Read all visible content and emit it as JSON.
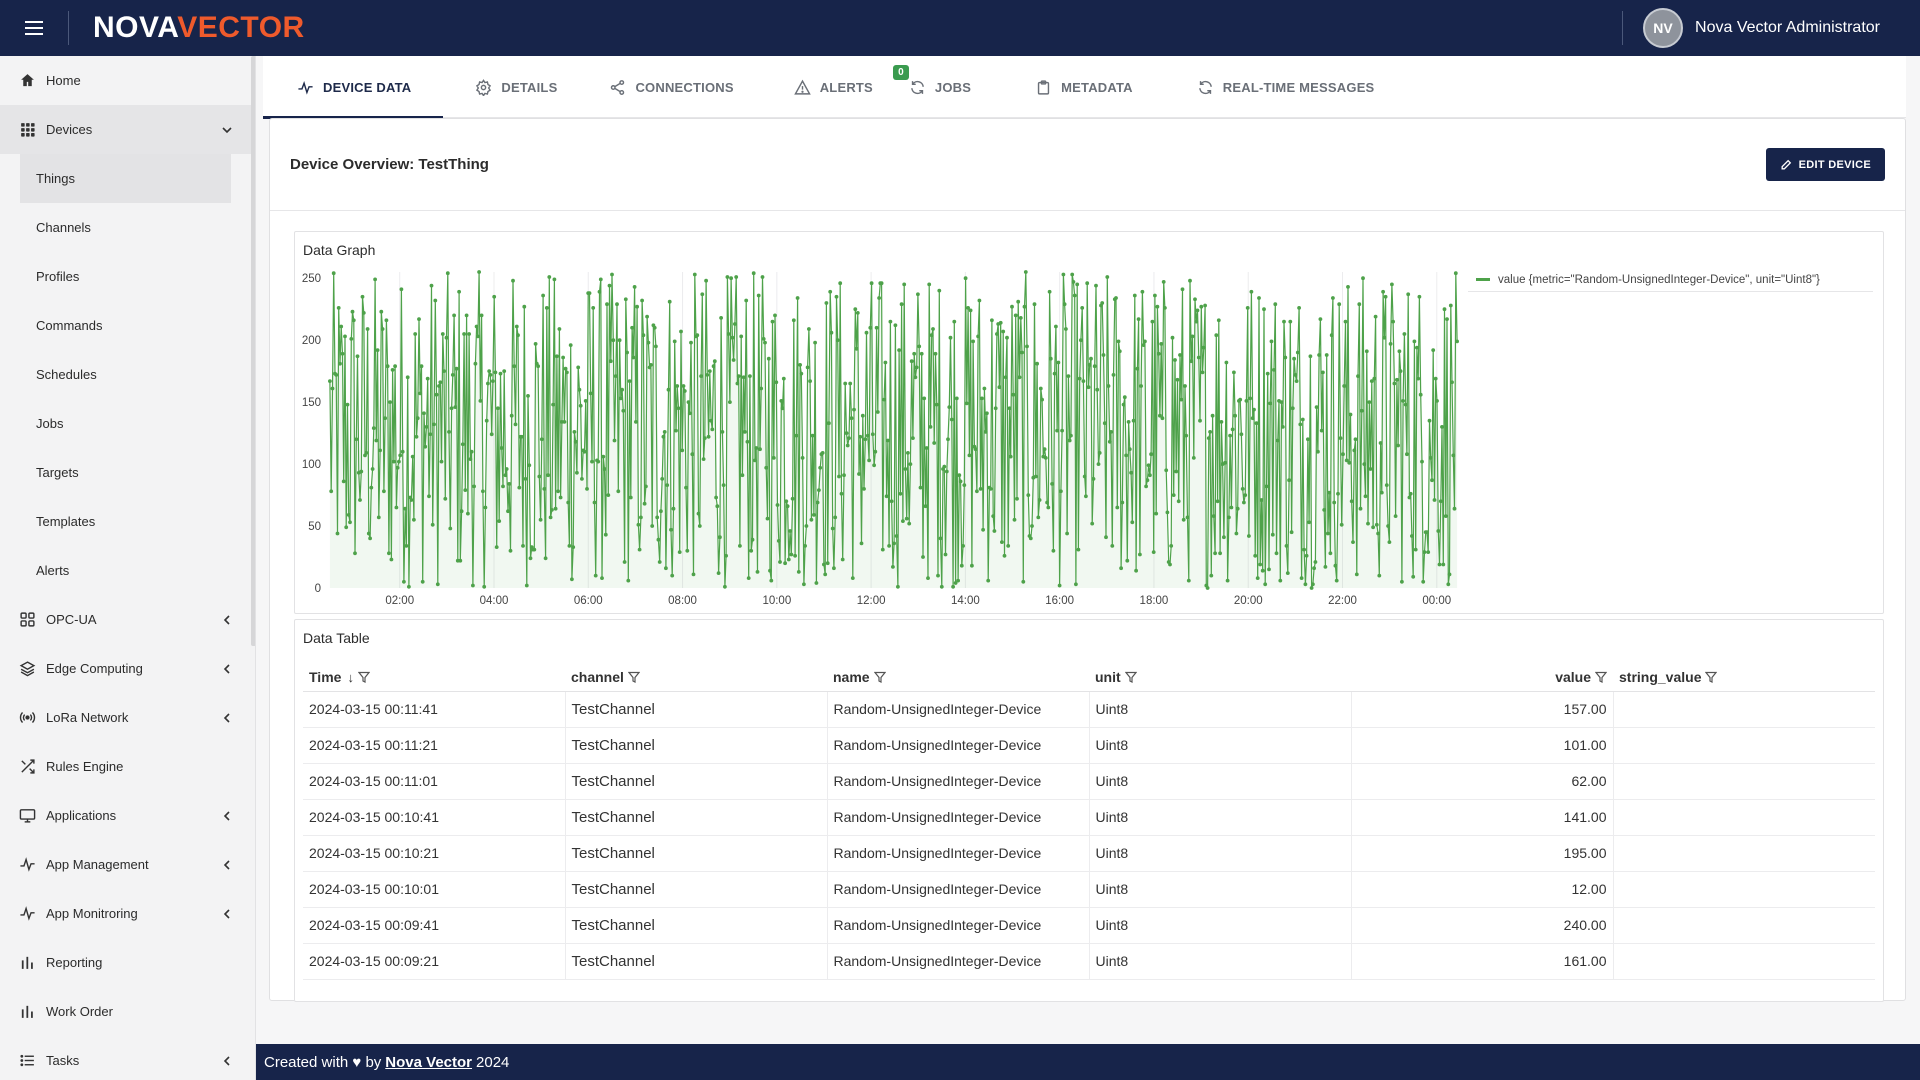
{
  "app": {
    "logo_part1": "NOVA",
    "logo_part2": "VECTOR",
    "user_initials": "NV",
    "user_name": "Nova Vector Administrator"
  },
  "sidebar": {
    "items": [
      {
        "label": "Home",
        "icon": "home-icon"
      },
      {
        "label": "Devices",
        "icon": "grid-icon",
        "expanded": true
      },
      {
        "label": "OPC-UA",
        "icon": "apps-icon"
      },
      {
        "label": "Edge Computing",
        "icon": "layers-icon"
      },
      {
        "label": "LoRa Network",
        "icon": "antenna-icon"
      },
      {
        "label": "Rules Engine",
        "icon": "shuffle-icon"
      },
      {
        "label": "Applications",
        "icon": "monitor-icon"
      },
      {
        "label": "App Management",
        "icon": "pulse-icon"
      },
      {
        "label": "App Monitroring",
        "icon": "pulse-icon"
      },
      {
        "label": "Reporting",
        "icon": "bars-icon"
      },
      {
        "label": "Work Order",
        "icon": "bars-icon"
      },
      {
        "label": "Tasks",
        "icon": "list-icon"
      }
    ],
    "devices_sub": [
      "Things",
      "Channels",
      "Profiles",
      "Commands",
      "Schedules",
      "Jobs",
      "Targets",
      "Templates",
      "Alerts"
    ]
  },
  "tabs": [
    {
      "label": "DEVICE DATA",
      "icon": "pulse-icon"
    },
    {
      "label": "DETAILS",
      "icon": "gear-icon"
    },
    {
      "label": "CONNECTIONS",
      "icon": "share-icon"
    },
    {
      "label": "ALERTS",
      "icon": "warning-icon",
      "badge": "0"
    },
    {
      "label": "JOBS",
      "icon": "refresh-icon"
    },
    {
      "label": "METADATA",
      "icon": "clipboard-icon"
    },
    {
      "label": "REAL-TIME MESSAGES",
      "icon": "refresh-icon"
    }
  ],
  "panel": {
    "title": "Device Overview: TestThing",
    "edit_label": "EDIT DEVICE"
  },
  "graph": {
    "title": "Data Graph",
    "legend": "value {metric=\"Random-UnsignedInteger-Device\", unit=\"Uint8\"}"
  },
  "chart_data": {
    "type": "line",
    "title": "Data Graph",
    "x_ticks": [
      "02:00",
      "04:00",
      "06:00",
      "08:00",
      "10:00",
      "12:00",
      "14:00",
      "16:00",
      "18:00",
      "20:00",
      "22:00",
      "00:00"
    ],
    "y_ticks": [
      0,
      50,
      100,
      150,
      200,
      250
    ],
    "ylim": [
      0,
      255
    ],
    "xlim_hours": [
      0.5,
      24.45
    ],
    "series": [
      {
        "name": "value {metric=\"Random-UnsignedInteger-Device\", unit=\"Uint8\"}",
        "color": "#4ea24a",
        "range": [
          0,
          255
        ],
        "interval_seconds": 20
      }
    ],
    "grid": true,
    "legend_position": "top-right"
  },
  "table": {
    "title": "Data Table",
    "columns": [
      "Time",
      "channel",
      "name",
      "unit",
      "value",
      "string_value"
    ],
    "rows": [
      [
        "2024-03-15 00:11:41",
        "TestChannel",
        "Random-UnsignedInteger-Device",
        "Uint8",
        "157.00",
        ""
      ],
      [
        "2024-03-15 00:11:21",
        "TestChannel",
        "Random-UnsignedInteger-Device",
        "Uint8",
        "101.00",
        ""
      ],
      [
        "2024-03-15 00:11:01",
        "TestChannel",
        "Random-UnsignedInteger-Device",
        "Uint8",
        "62.00",
        ""
      ],
      [
        "2024-03-15 00:10:41",
        "TestChannel",
        "Random-UnsignedInteger-Device",
        "Uint8",
        "141.00",
        ""
      ],
      [
        "2024-03-15 00:10:21",
        "TestChannel",
        "Random-UnsignedInteger-Device",
        "Uint8",
        "195.00",
        ""
      ],
      [
        "2024-03-15 00:10:01",
        "TestChannel",
        "Random-UnsignedInteger-Device",
        "Uint8",
        "12.00",
        ""
      ],
      [
        "2024-03-15 00:09:41",
        "TestChannel",
        "Random-UnsignedInteger-Device",
        "Uint8",
        "240.00",
        ""
      ],
      [
        "2024-03-15 00:09:21",
        "TestChannel",
        "Random-UnsignedInteger-Device",
        "Uint8",
        "161.00",
        ""
      ]
    ]
  },
  "footer": {
    "prefix": "Created with ♥ by",
    "link": "Nova Vector",
    "suffix": "2024"
  },
  "colors": {
    "navy": "#17244a",
    "accent_orange": "#ef5a2c",
    "series_green": "#4ea24a",
    "badge_green": "#3a9b4f"
  }
}
